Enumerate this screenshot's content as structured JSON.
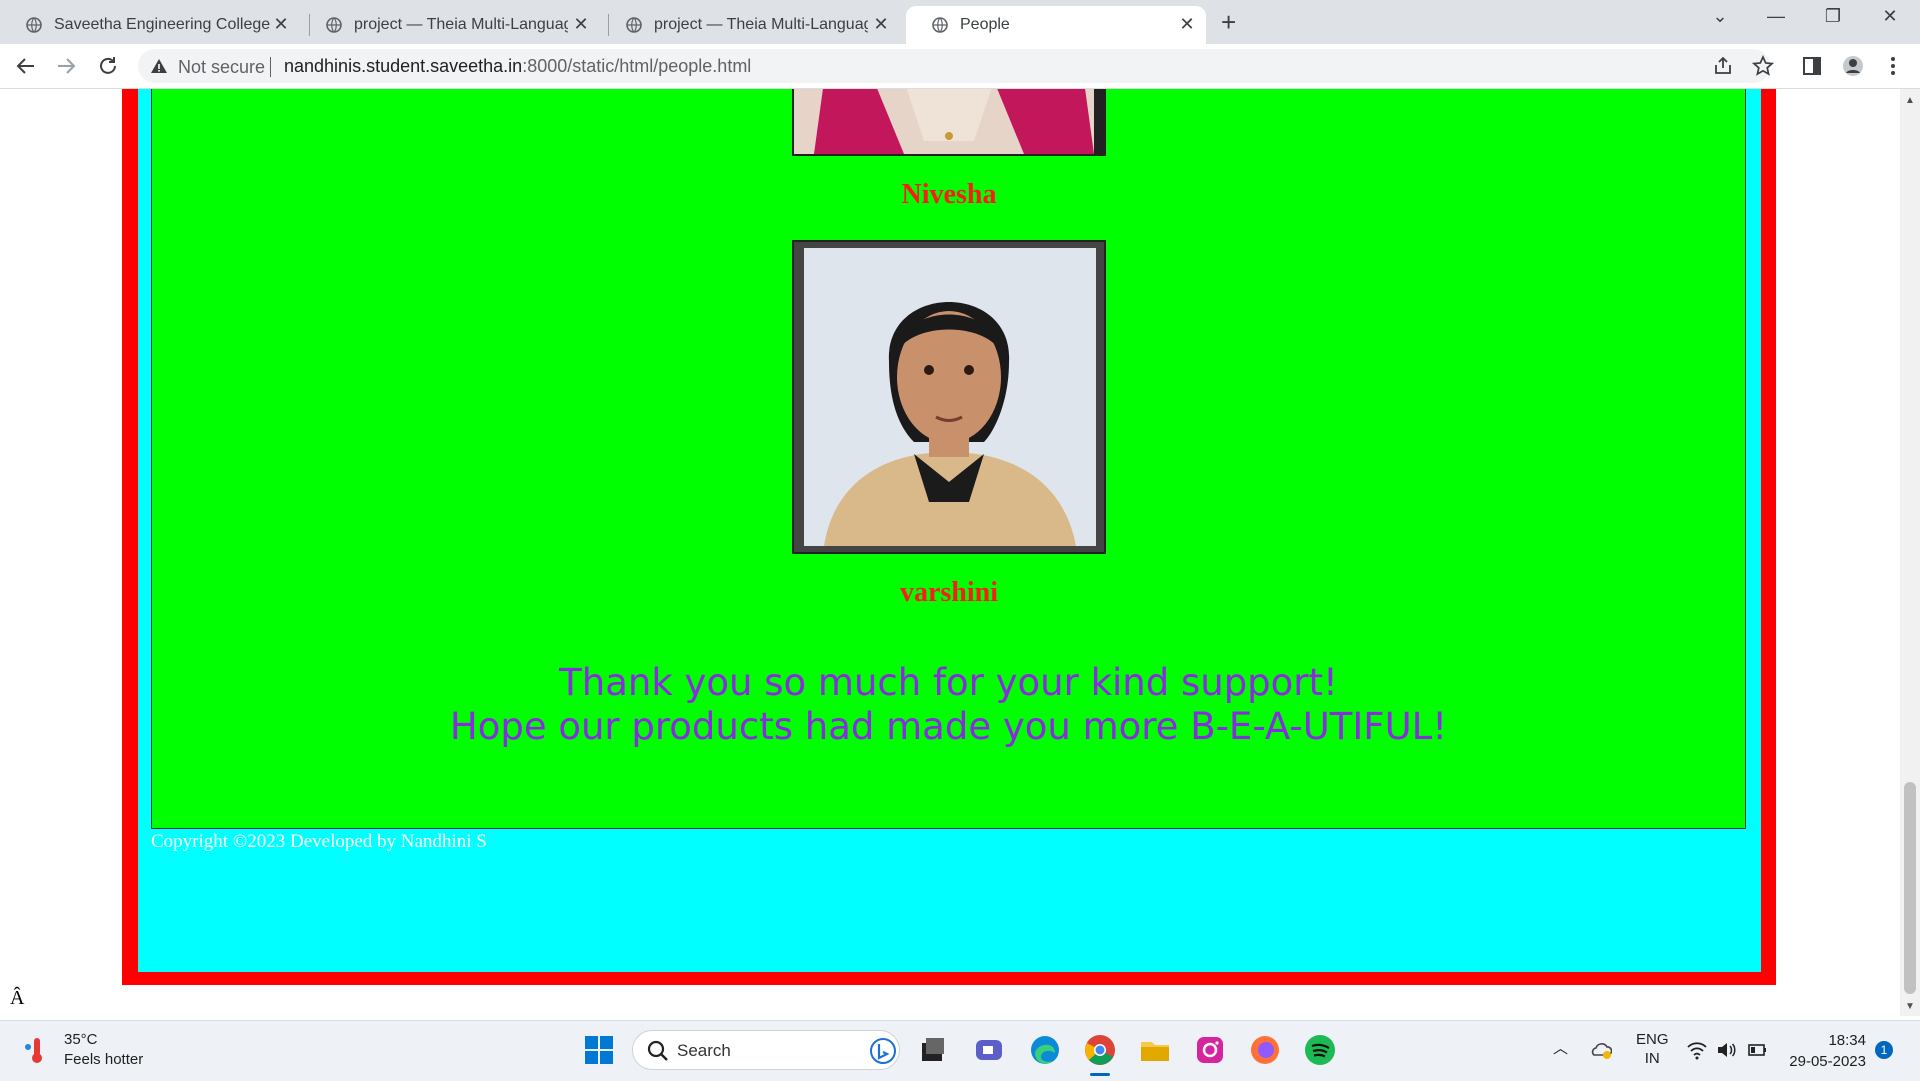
{
  "browser": {
    "tabs": [
      {
        "title": "Saveetha Engineering College",
        "active": false
      },
      {
        "title": "project — Theia Multi-Language",
        "active": false
      },
      {
        "title": "project — Theia Multi-Language",
        "active": false
      },
      {
        "title": "People",
        "active": true
      }
    ],
    "address": {
      "security_label": "Not secure",
      "host": "nandhinis.student.saveetha.in",
      "path": ":8000/static/html/people.html"
    }
  },
  "page": {
    "people": [
      {
        "name": "Nivesha"
      },
      {
        "name": "varshini"
      }
    ],
    "thanks_line1": "Thank you so much for your kind support!",
    "thanks_line2": "Hope our products had made you more B-E-A-UTIFUL!",
    "copyright": "Copyright ©2023 Developed by Nandhini S",
    "stray_char": "Â",
    "colors": {
      "frame": "#ff0000",
      "background": "#00ffff",
      "panel": "#00ff00",
      "name": "#ff1a1a",
      "thanks": "#8a2be2"
    }
  },
  "taskbar": {
    "weather_temp": "35°C",
    "weather_desc": "Feels hotter",
    "search_label": "Search",
    "lang_top": "ENG",
    "lang_bottom": "IN",
    "time": "18:34",
    "date": "29-05-2023",
    "notifications": "1"
  }
}
